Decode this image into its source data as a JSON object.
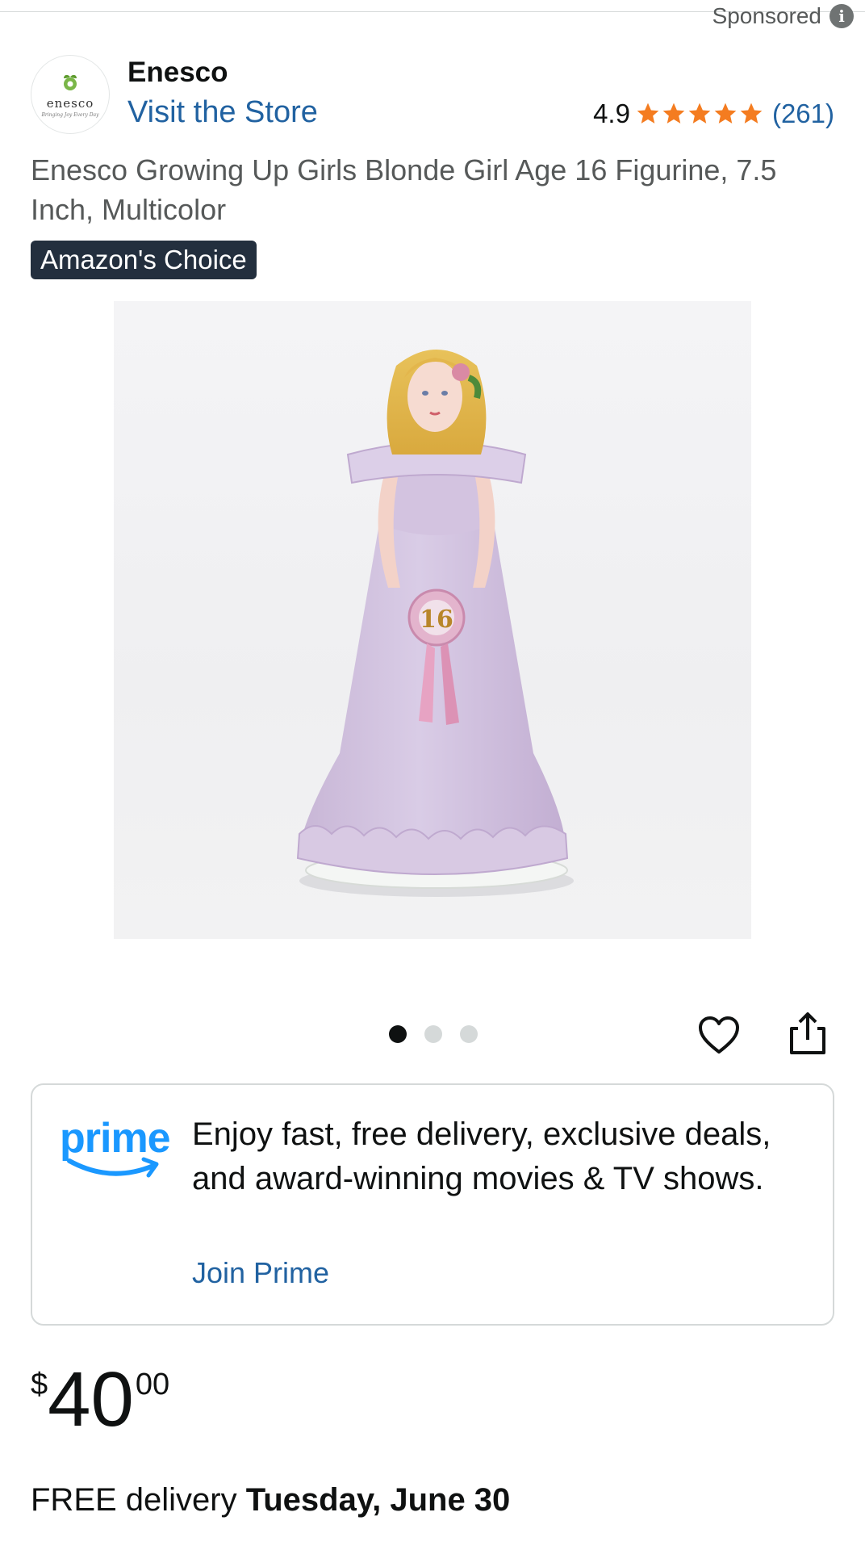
{
  "header": {
    "sponsored_label": "Sponsored",
    "info_icon": "info-icon"
  },
  "brand": {
    "logo_word": "enesco",
    "logo_tagline": "Bringing Joy Every Day",
    "name": "Enesco",
    "visit_store": "Visit the Store"
  },
  "rating": {
    "value": "4.9",
    "stars": 5,
    "count": "(261)",
    "star_color": "#f47c20"
  },
  "product": {
    "title": "Enesco Growing Up Girls Blonde Girl Age 16 Figurine, 7.5 Inch, Multicolor",
    "badge": "Amazon's Choice",
    "figurine_number": "16"
  },
  "carousel": {
    "total": 3,
    "active_index": 0
  },
  "actions": {
    "wishlist_icon": "heart-icon",
    "share_icon": "share-icon"
  },
  "prime": {
    "logo_text": "prime",
    "message": "Enjoy fast, free delivery, exclusive deals, and award-winning movies & TV shows.",
    "cta": "Join Prime",
    "color": "#1a98ff"
  },
  "price": {
    "symbol": "$",
    "whole": "40",
    "fraction": "00"
  },
  "delivery": {
    "prefix": "FREE delivery",
    "date": "Tuesday, June 30"
  },
  "colors": {
    "link": "#2162a1",
    "badge_bg": "#232f3e",
    "text": "#0f1111",
    "muted": "#565959"
  }
}
